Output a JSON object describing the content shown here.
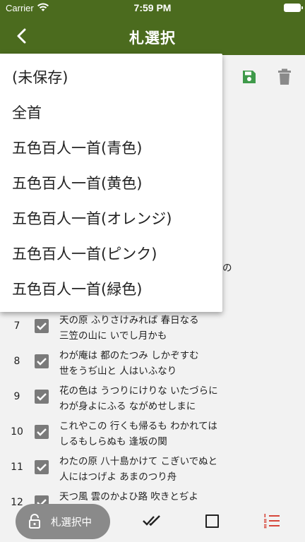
{
  "status_bar": {
    "carrier": "Carrier",
    "time": "7:59 PM"
  },
  "header": {
    "title": "札選択"
  },
  "dropdown": {
    "items": [
      {
        "label": "(未保存)"
      },
      {
        "label": "全首"
      },
      {
        "label": "五色百人一首(青色)"
      },
      {
        "label": "五色百人一首(黄色)"
      },
      {
        "label": "五色百人一首(オレンジ)"
      },
      {
        "label": "五色百人一首(ピンク)"
      },
      {
        "label": "五色百人一首(緑色)"
      }
    ]
  },
  "list": {
    "clipped_fragment": "の",
    "rows": [
      {
        "number": "7",
        "line1": "天の原 ふりさけみれば 春日なる",
        "line2": "三笠の山に いでし月かも",
        "checked": true
      },
      {
        "number": "8",
        "line1": "わが庵は 都のたつみ しかぞすむ",
        "line2": "世をうぢ山と 人はいふなり",
        "checked": true
      },
      {
        "number": "9",
        "line1": "花の色は うつりにけりな いたづらに",
        "line2": "わが身よにふる ながめせしまに",
        "checked": true
      },
      {
        "number": "10",
        "line1": "これやこの 行くも帰るも わかれては",
        "line2": "しるもしらぬも 逢坂の関",
        "checked": true
      },
      {
        "number": "11",
        "line1": "わたの原 八十島かけて こぎいでぬと",
        "line2": "人にはつげよ あまのつり舟",
        "checked": true
      },
      {
        "number": "12",
        "line1": "天つ風 雲のかよひ路 吹きとぢよ",
        "line2": "",
        "checked": true
      }
    ]
  },
  "bottom_bar": {
    "fab_label": "札選択中"
  },
  "icons": {
    "back": "chevron-left-icon",
    "save": "save-icon",
    "delete": "trash-icon",
    "lock": "lock-open-icon",
    "select_all": "done-all-icon",
    "deselect": "square-outline-icon",
    "order": "ordered-list-icon"
  },
  "colors": {
    "header": "#4b6b1e",
    "save": "#3f9a4a",
    "trash": "#8a8a8a",
    "order_icon": "#d6463a",
    "fab": "#8a8a8a"
  }
}
